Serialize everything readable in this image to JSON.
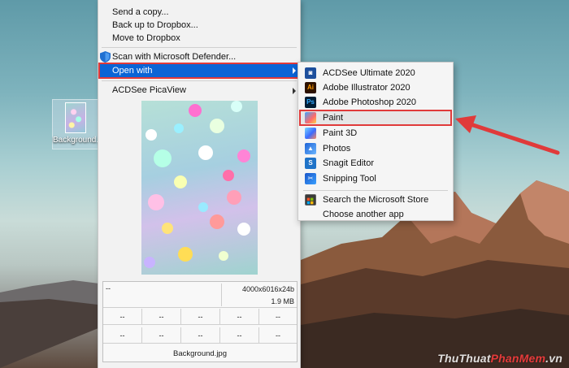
{
  "desktop": {
    "file_label": "Background.jpg",
    "watermark_part1": "ThuThuat",
    "watermark_part2": "PhanMem",
    "watermark_part3": ".vn"
  },
  "context_menu": {
    "items": [
      {
        "label": "Send a copy..."
      },
      {
        "label": "Back up to Dropbox..."
      },
      {
        "label": "Move to Dropbox"
      },
      {
        "label": "Scan with Microsoft Defender..."
      },
      {
        "label": "Open with"
      },
      {
        "label": "ACDSee PicaView"
      }
    ],
    "preview_info": {
      "top_left": "--",
      "dimensions": "4000x6016x24b",
      "size": "1.9 MB",
      "grid": [
        "--",
        "--",
        "--",
        "--",
        "--",
        "--",
        "--",
        "--",
        "--",
        "--"
      ],
      "filename": "Background.jpg"
    }
  },
  "open_with_submenu": {
    "items": [
      {
        "label": "ACDSee Ultimate 2020",
        "icon": "acdsee-icon"
      },
      {
        "label": "Adobe Illustrator 2020",
        "icon": "illustrator-icon",
        "icon_text": "Ai"
      },
      {
        "label": "Adobe Photoshop 2020",
        "icon": "photoshop-icon",
        "icon_text": "Ps"
      },
      {
        "label": "Paint",
        "icon": "paint-icon",
        "highlighted": true
      },
      {
        "label": "Paint 3D",
        "icon": "paint3d-icon"
      },
      {
        "label": "Photos",
        "icon": "photos-icon"
      },
      {
        "label": "Snagit Editor",
        "icon": "snagit-icon",
        "icon_text": "S"
      },
      {
        "label": "Snipping Tool",
        "icon": "snipping-tool-icon"
      },
      {
        "label": "Search the Microsoft Store",
        "icon": "store-icon"
      },
      {
        "label": "Choose another app",
        "icon": ""
      }
    ]
  },
  "colors": {
    "highlight_blue": "#0a64d6",
    "annotation_red": "#e03a3a"
  }
}
